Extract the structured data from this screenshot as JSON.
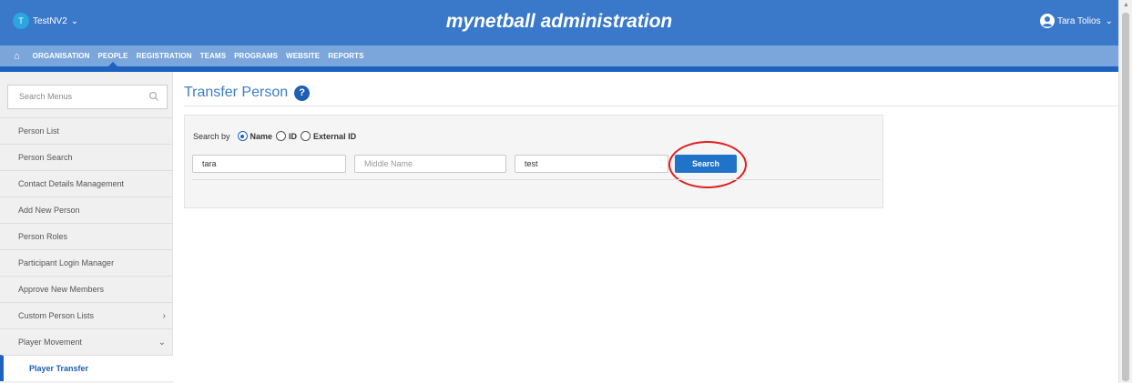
{
  "header": {
    "org_initial": "T",
    "org_name": "TestNV2",
    "app_title": "mynetball administration",
    "user_name": "Tara Tolios"
  },
  "nav": {
    "items": [
      "ORGANISATION",
      "PEOPLE",
      "REGISTRATION",
      "TEAMS",
      "PROGRAMS",
      "WEBSITE",
      "REPORTS"
    ],
    "active": "PEOPLE"
  },
  "sidebar": {
    "search_placeholder": "Search Menus",
    "items": [
      {
        "label": "Person List"
      },
      {
        "label": "Person Search"
      },
      {
        "label": "Contact Details Management"
      },
      {
        "label": "Add New Person"
      },
      {
        "label": "Person Roles"
      },
      {
        "label": "Participant Login Manager"
      },
      {
        "label": "Approve New Members"
      },
      {
        "label": "Custom Person Lists"
      },
      {
        "label": "Player Movement"
      },
      {
        "label": "Player Transfer"
      }
    ]
  },
  "main": {
    "title": "Transfer Person",
    "help_glyph": "?",
    "search_by_label": "Search by",
    "radio_options": [
      "Name",
      "ID",
      "External ID"
    ],
    "selected_option": "Name",
    "first_name_value": "tara",
    "middle_name_placeholder": "Middle Name",
    "last_name_value": "test",
    "search_button": "Search"
  },
  "colors": {
    "header_bg": "#3a78c9",
    "nav_bg": "#7aa6dc",
    "accent": "#1e62c0",
    "button": "#1f73c9",
    "highlight": "#e02020"
  }
}
